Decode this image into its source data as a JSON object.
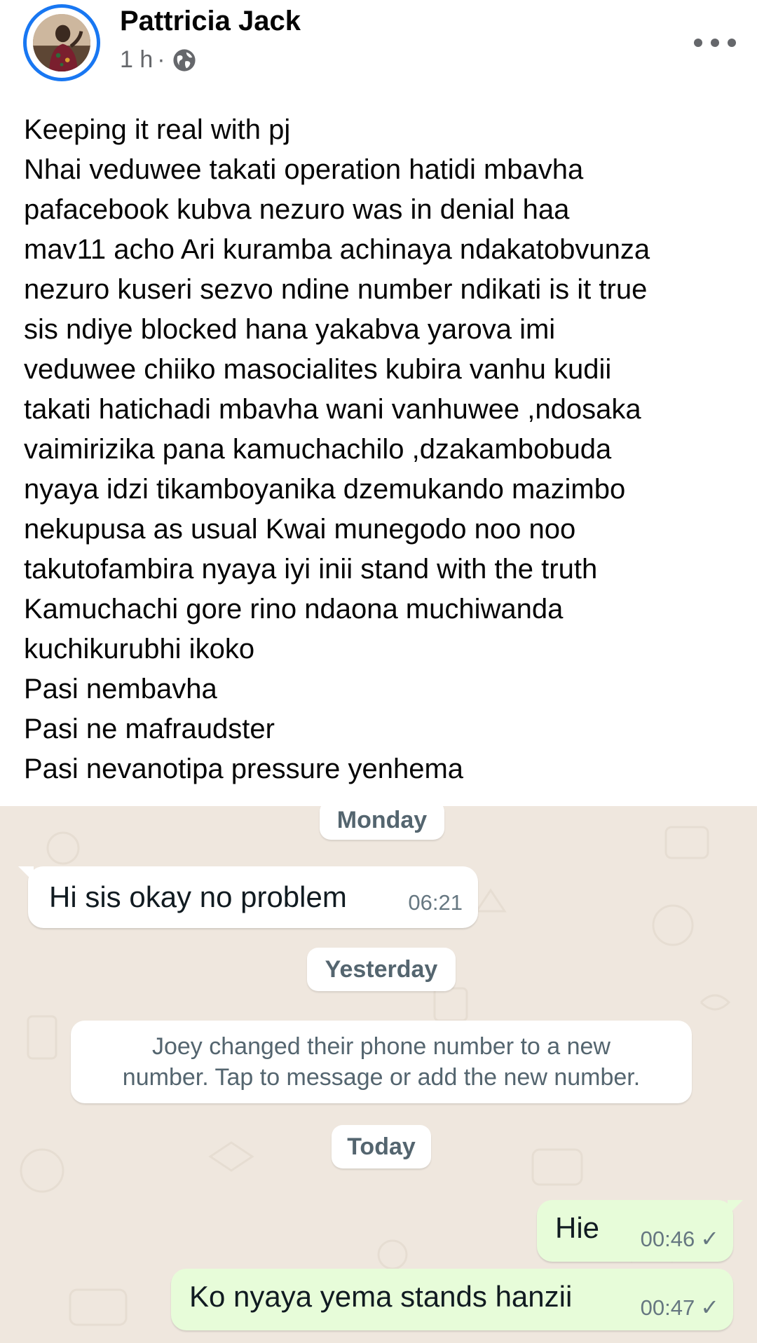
{
  "post": {
    "author": "Pattricia Jack",
    "time": "1 h",
    "separator": "·",
    "privacy_icon": "globe-icon",
    "more_icon": "more-options-icon",
    "text_lines": [
      "Keeping it real with pj",
      "Nhai veduwee takati operation hatidi mbavha",
      "pafacebook kubva nezuro was in denial haa",
      "mav11 acho Ari kuramba achinaya ndakatobvunza",
      "nezuro kuseri sezvo ndine number ndikati is it true",
      "sis ndiye blocked hana yakabva yarova imi",
      "veduwee chiiko masocialites kubira vanhu kudii",
      "takati hatichadi mbavha wani vanhuwee ,ndosaka",
      "vaimirizika pana kamuchachilo ,dzakambobuda",
      "nyaya idzi tikamboyanika dzemukando mazimbo",
      "nekupusa as usual Kwai munegodo noo noo",
      "takutofambira nyaya iyi inii stand with the truth",
      "Kamuchachi gore rino ndaona muchiwanda",
      "kuchikurubhi ikoko",
      "Pasi nembavha",
      "Pasi ne mafraudster",
      "Pasi nevanotipa pressure yenhema"
    ]
  },
  "chat": {
    "background_color": "#efe7de",
    "day_monday": "Monday",
    "incoming_message": {
      "text": "Hi sis okay no problem",
      "time": "06:21"
    },
    "day_yesterday": "Yesterday",
    "system_message": {
      "line1": "Joey changed their phone number to a new",
      "line2": "number. Tap to message or add the new number."
    },
    "day_today": "Today",
    "outgoing_messages": [
      {
        "text": "Hie",
        "time": "00:46",
        "tick": "✓"
      },
      {
        "text": "Ko nyaya yema stands hanzii",
        "time": "00:47",
        "tick": "✓"
      }
    ]
  },
  "colors": {
    "facebook_blue": "#1877f2",
    "outgoing_bubble": "#e7fcd9",
    "muted_text": "#65676b"
  }
}
